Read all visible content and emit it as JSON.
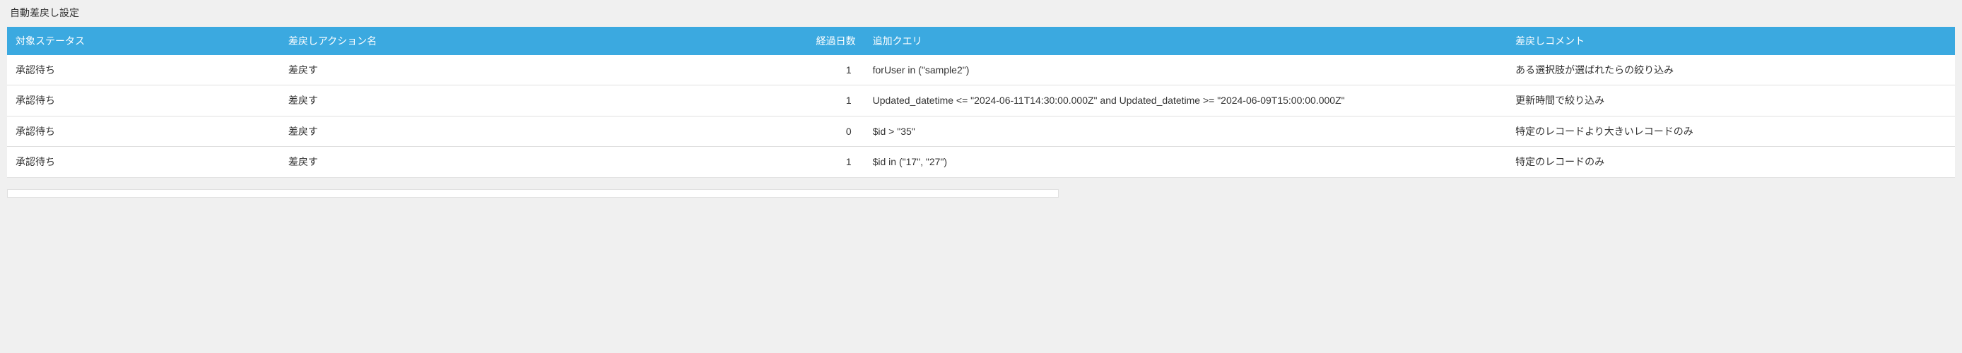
{
  "section": {
    "title": "自動差戻し設定"
  },
  "table": {
    "headers": {
      "status": "対象ステータス",
      "action": "差戻しアクション名",
      "days": "経過日数",
      "query": "追加クエリ",
      "comment": "差戻しコメント"
    },
    "rows": [
      {
        "status": "承認待ち",
        "action": "差戻す",
        "days": "1",
        "query": "forUser in (\"sample2\")",
        "comment": "ある選択肢が選ばれたらの絞り込み"
      },
      {
        "status": "承認待ち",
        "action": "差戻す",
        "days": "1",
        "query": "Updated_datetime <= \"2024-06-11T14:30:00.000Z\" and Updated_datetime >= \"2024-06-09T15:00:00.000Z\"",
        "comment": "更新時間で絞り込み"
      },
      {
        "status": "承認待ち",
        "action": "差戻す",
        "days": "0",
        "query": "$id > \"35\"",
        "comment": "特定のレコードより大きいレコードのみ"
      },
      {
        "status": "承認待ち",
        "action": "差戻す",
        "days": "1",
        "query": "$id in (\"17\", \"27\")",
        "comment": "特定のレコードのみ"
      }
    ]
  }
}
